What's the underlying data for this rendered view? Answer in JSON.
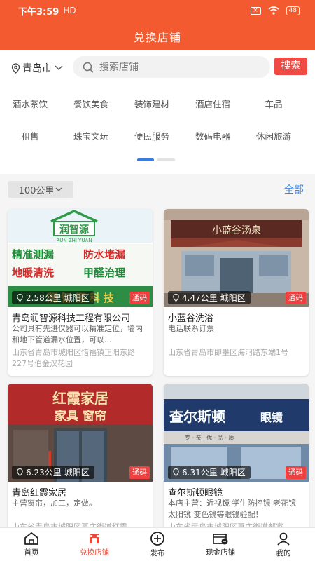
{
  "status_bar": {
    "time": "下午3:59",
    "extra": "HD",
    "battery": "48"
  },
  "header": {
    "title": "兑换店铺"
  },
  "search": {
    "city": "青岛市",
    "placeholder": "搜索店铺",
    "button": "搜索"
  },
  "categories": [
    "酒水茶饮",
    "餐饮美食",
    "装饰建材",
    "酒店住宿",
    "车品",
    "租售",
    "珠宝文玩",
    "便民服务",
    "数码电器",
    "休闲旅游"
  ],
  "filter": {
    "distance": "100公里",
    "all": "全部"
  },
  "shops": [
    {
      "distance": "2.58公里",
      "district": "城阳区",
      "coupon": "通码",
      "name": "青岛润智源科技工程有限公司",
      "desc": "公司具有先进仪器可以精准定位，墙内和地下管道漏水位置，可以...",
      "address": "山东省青岛市城阳区惜福镇正阳东路227号伯金汉花园",
      "sign": {
        "brand": "润智源",
        "pinyin": "RUN ZHI YUAN",
        "line1a": "精准测漏",
        "line1b": "防水堵漏",
        "line2a": "地暖清洗",
        "line2b": "甲醛治理",
        "bottom": "润 智 源 科 技"
      }
    },
    {
      "distance": "4.47公里",
      "district": "城阳区",
      "coupon": "通码",
      "name": "小蓝谷洗浴",
      "desc": "电话联系订票",
      "address": "山东省青岛市即墨区海河路东端1号",
      "sign": {
        "brand": "小蓝谷汤泉"
      }
    },
    {
      "distance": "6.23公里",
      "district": "城阳区",
      "coupon": "通码",
      "name": "青岛红霞家居",
      "desc": "主营窗帘，加工，定做。",
      "address": "山东省青岛市城阳区夏庄街道红霞",
      "sign": {
        "line1": "红霞家居",
        "line2": "家具  窗帘"
      }
    },
    {
      "distance": "6.31公里",
      "district": "城阳区",
      "coupon": "通码",
      "name": "查尔斯顿眼镜",
      "desc": "本店主营：近视镜 学生防控镜 老花镜 太阳镜 变色镜等眼镜验配！",
      "address": "山东省青岛市城阳区夏庄街道郝家",
      "sign": {
        "brand": "查尔斯顿",
        "suffix": "眼镜",
        "sub": "专 · 亲 · 优 · 品 · 质"
      }
    }
  ],
  "tabbar": [
    {
      "label": "首页",
      "icon": "home-icon"
    },
    {
      "label": "兑换店铺",
      "icon": "store-icon"
    },
    {
      "label": "发布",
      "icon": "plus-circle-icon"
    },
    {
      "label": "现金店铺",
      "icon": "shop-cash-icon"
    },
    {
      "label": "我的",
      "icon": "user-icon"
    }
  ],
  "colors": {
    "brand": "#f35a30",
    "accent_blue": "#3d86e8",
    "tag_red": "#ef3f3f"
  }
}
